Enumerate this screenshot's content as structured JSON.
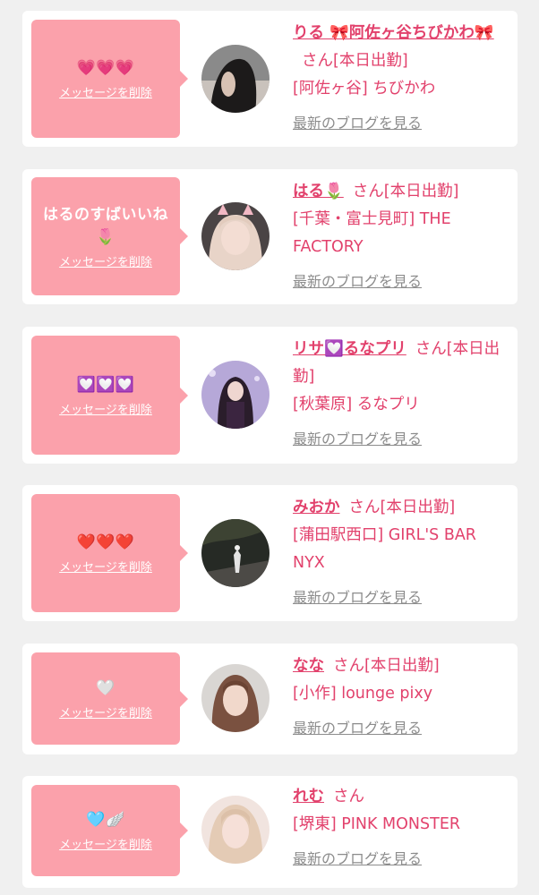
{
  "delete_label": "メッセージを削除",
  "blog_label": "最新のブログを見る",
  "san_label": "さん",
  "status_label": "[本日出勤]",
  "colors": {
    "accent": "#e2416c",
    "bubble": "#fba1ab",
    "background": "#f0f0f0"
  },
  "entries": [
    {
      "message": "💗💗💗",
      "name": "りる 🎀阿佐ヶ谷ちびかわ🎀",
      "location": "[阿佐ヶ谷] ちびかわ",
      "avatar": "avatar-photo-dark-hair"
    },
    {
      "message": "はるのすばいいね🌷",
      "name": "はる🌷",
      "location": "[千葉・富士見町] THE FACTORY",
      "avatar": "avatar-photo-cat-ears"
    },
    {
      "message": "💟💟💟",
      "name": "リサ💟るなプリ",
      "location": "[秋葉原] るなプリ",
      "avatar": "avatar-photo-gothic"
    },
    {
      "message": "❤️❤️❤️",
      "name": "みおか",
      "location": "[蒲田駅西口] GIRL'S BAR NYX",
      "avatar": "avatar-photo-night"
    },
    {
      "message": "🤍",
      "name": "なな",
      "location": "[小作] lounge pixy",
      "avatar": "avatar-photo-brown-hair"
    },
    {
      "message": "🩵🪽",
      "name": "れむ",
      "location": "[堺東] PINK MONSTER",
      "avatar": "avatar-photo-blonde"
    }
  ]
}
